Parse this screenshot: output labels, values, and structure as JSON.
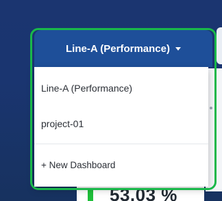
{
  "dashboard_selector": {
    "selected_label": "Line-A (Performance)",
    "caret_icon": "caret-down-icon",
    "options": [
      {
        "label": "Line-A (Performance)"
      },
      {
        "label": "project-01"
      }
    ],
    "new_dashboard_label": "+ New Dashboard"
  },
  "background_widget": {
    "percentage_text": "53.03 %"
  },
  "colors": {
    "header_blue": "#1e4f99",
    "highlight_green": "#19b84a",
    "gauge_green": "#1fbf3a"
  }
}
